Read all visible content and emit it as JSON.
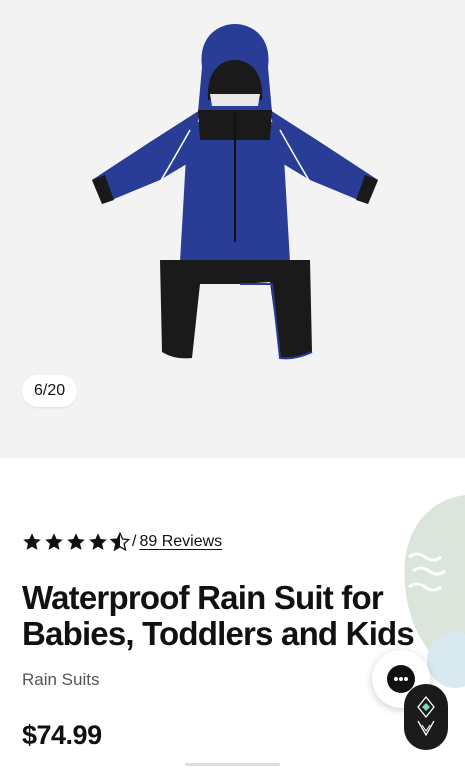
{
  "gallery": {
    "counter": "6/20",
    "image_alt": "Blue waterproof rain suit with black legs and hood"
  },
  "rating": {
    "value": 4.5,
    "max": 5,
    "separator": "/",
    "reviews_label": "89 Reviews"
  },
  "product": {
    "title": "Waterproof Rain Suit for Babies, Toddlers and Kids",
    "category": "Rain Suits",
    "price": "$74.99"
  },
  "colors": {
    "suit_blue": "#2a3d96",
    "suit_black": "#1a1a1a",
    "gallery_bg": "#f3f3f3",
    "deco_green": "#dbe5dc"
  },
  "icons": {
    "chat": "chat-bubble-icon",
    "brand": "brand-logo-icon",
    "star": "star-icon"
  }
}
